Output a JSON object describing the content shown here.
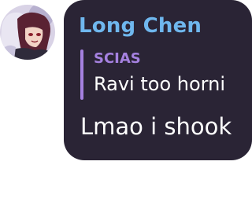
{
  "message": {
    "author": "Long Chen",
    "author_color": "#6fb7ee",
    "reply": {
      "author": "SCIAS",
      "author_color": "#a581e0",
      "text": "Ravi too horni"
    },
    "text": "Lmao i shook"
  },
  "avatar": {
    "icon": "user-avatar"
  },
  "colors": {
    "bubble": "#2a2435",
    "reply_bar": "#a581e0",
    "text": "#ffffff"
  }
}
